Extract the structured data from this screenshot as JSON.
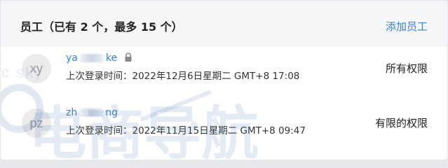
{
  "header": {
    "title": "员工（已有 2 个，最多 15 个）",
    "add_link": "添加员工"
  },
  "employees": [
    {
      "avatar_initials": "xy",
      "name_prefix": "ya",
      "name_suffix": "ke",
      "lock": "lock-icon",
      "login_label": "上次登录时间：",
      "login_time": "2022年12月6日星期二 GMT+8 17:08",
      "permission": "所有权限"
    },
    {
      "avatar_initials": "pz",
      "name_prefix": "zh",
      "name_suffix": "ng",
      "login_label": "上次登录时间：",
      "login_time": "2022年11月15日星期二 GMT+8 09:47",
      "permission": "有限的权限"
    }
  ],
  "watermark": {
    "text": "电商导航",
    "small_text": "ic sky"
  },
  "colors": {
    "accent": "#3d7fc4",
    "header_bg": "#f5f6f7",
    "avatar_bg": "#ebebeb"
  }
}
